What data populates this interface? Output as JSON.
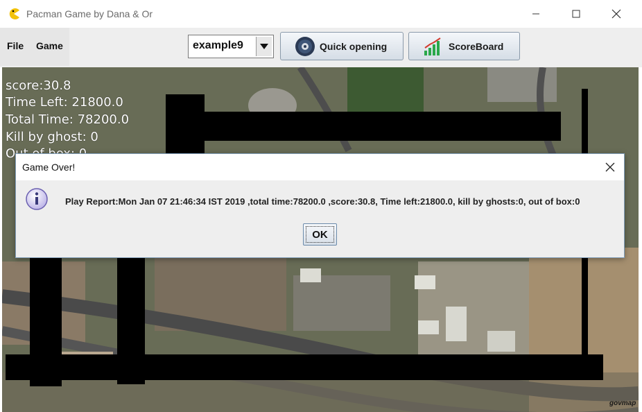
{
  "window": {
    "title": "Pacman Game by Dana & Or",
    "controls": [
      "minimize-icon",
      "maximize-icon",
      "close-icon"
    ]
  },
  "menu": {
    "items": [
      "File",
      "Game"
    ]
  },
  "toolbar": {
    "map_select": {
      "value": "example9"
    },
    "quick_opening_label": "Quick opening",
    "scoreboard_label": "ScoreBoard"
  },
  "hud": {
    "score": "score:30.8",
    "time_left": "Time Left: 21800.0",
    "total_time": "Total Time: 78200.0",
    "kill_by_ghost": "Kill by ghost: 0",
    "out_of_box": "Out of box: 0"
  },
  "dialog": {
    "title": "Game Over!",
    "message": "Play Report:Mon Jan 07 21:46:34 IST 2019 ,total time:78200.0 ,score:30.8, Time left:21800.0, kill by ghosts:0, out of box:0",
    "ok_label": "OK",
    "icon": "info-icon"
  },
  "map_watermark": "govmap",
  "colors": {
    "wall": "#000000",
    "hud_text": "#ffffff",
    "dialog_bg": "#eeeeee",
    "pacman_icon": "#f2c20a"
  }
}
